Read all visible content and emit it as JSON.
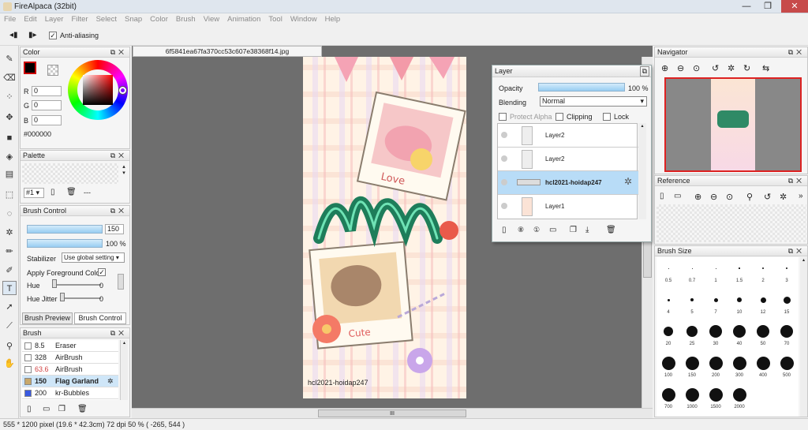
{
  "window": {
    "title": "FireAlpaca (32bit)"
  },
  "menu": [
    "File",
    "Edit",
    "Layer",
    "Filter",
    "Select",
    "Snap",
    "Color",
    "Brush",
    "View",
    "Animation",
    "Tool",
    "Window",
    "Help"
  ],
  "toolbar": {
    "anti_aliasing": "Anti-aliasing"
  },
  "color_panel": {
    "title": "Color",
    "r_label": "R",
    "g_label": "G",
    "b_label": "B",
    "r": "0",
    "g": "0",
    "b": "0",
    "hex": "#000000"
  },
  "palette": {
    "title": "Palette",
    "number": "#1",
    "dashes": "---"
  },
  "brush_control": {
    "title": "Brush Control",
    "size": "150",
    "opacity": "100 %",
    "stabilizer_label": "Stabilizer",
    "stabilizer_value": "Use global setting",
    "apply_fg": "Apply Foreground Color",
    "hue": "Hue",
    "hue_val": "0",
    "hue_jitter": "Hue Jitter",
    "hue_jitter_val": "0",
    "tab_preview": "Brush Preview",
    "tab_control": "Brush Control"
  },
  "brush_list": {
    "title": "Brush",
    "items": [
      {
        "size": "8.5",
        "name": "Eraser",
        "color": "#ffffff"
      },
      {
        "size": "328",
        "name": "AirBrush",
        "color": "#ffffff"
      },
      {
        "size": "63.6",
        "name": "AirBrush",
        "color": "#ffffff"
      },
      {
        "size": "150",
        "name": "Flag Garland",
        "color": "#c8a86a"
      },
      {
        "size": "200",
        "name": "kr-Bubbles",
        "color": "#3a5ae0"
      }
    ]
  },
  "document": {
    "tab": "6f5841ea67fa370cc53c607e38368f14.jpg",
    "credit": "hcl2021-hoidap247"
  },
  "layer_panel": {
    "title": "Layer",
    "opacity_label": "Opacity",
    "opacity_val": "100 %",
    "blending_label": "Blending",
    "blending_val": "Normal",
    "protect_alpha": "Protect Alpha",
    "clipping": "Clipping",
    "lock": "Lock",
    "layers": [
      {
        "name": "Layer2"
      },
      {
        "name": "Layer2"
      },
      {
        "name": "hcl2021-hoidap247"
      },
      {
        "name": "Layer1"
      }
    ]
  },
  "navigator": {
    "title": "Navigator"
  },
  "reference": {
    "title": "Reference"
  },
  "brush_size": {
    "title": "Brush Size",
    "sizes": [
      "0.5",
      "0.7",
      "1",
      "1.5",
      "2",
      "3",
      "4",
      "5",
      "7",
      "10",
      "12",
      "15",
      "20",
      "25",
      "30",
      "40",
      "50",
      "70",
      "100",
      "150",
      "200",
      "300",
      "400",
      "500",
      "700",
      "1000",
      "1500",
      "2000"
    ]
  },
  "status": {
    "text": "555 * 1200 pixel  (19.6 * 42.3cm)  72 dpi  50 %  ( -265, 544 )"
  },
  "scroll": {
    "grip": "III"
  },
  "colors": {
    "accent": "#9ccff3",
    "selected_row": "#b8dcf7"
  }
}
